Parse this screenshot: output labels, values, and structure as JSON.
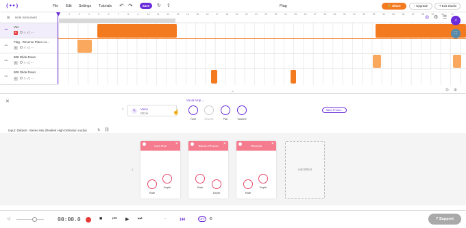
{
  "menu": {
    "file": "File",
    "edit": "Edit",
    "settings": "Settings",
    "tutorials": "Tutorials",
    "save": "Save"
  },
  "project_title": "Flag",
  "buttons": {
    "share": "Share",
    "upgrade": "Upgrade",
    "exit": "Exit Studio"
  },
  "hide_instrument": "Hide Instrument",
  "ruler": [
    "1",
    "2",
    "3",
    "4",
    "5",
    "6",
    "7",
    "8",
    "9",
    "10",
    "11",
    "12",
    "13",
    "14",
    "15",
    "16",
    "17",
    "18",
    "19",
    "20",
    "21",
    "22",
    "23",
    "24",
    "25",
    "26",
    "27",
    "28",
    "29",
    "30",
    "31",
    "32",
    "33",
    "34",
    "35",
    "36",
    "37",
    "38",
    "39",
    "40",
    "41"
  ],
  "tracks": [
    {
      "name": "Voc",
      "active": true
    },
    {
      "name": "Flag - Reverse Piano Lo...",
      "active": false
    },
    {
      "name": "808 Glide Down",
      "active": false
    },
    {
      "name": "808 Glide Down",
      "active": false
    }
  ],
  "instrument": {
    "voice_title": "Voice",
    "voice_sub": "Ditzie",
    "preset_name": "Vocal Amp",
    "knobs": [
      {
        "label": "Tone",
        "dim": false
      },
      {
        "label": "Reverb",
        "dim": true
      },
      {
        "label": "Pan",
        "dim": false
      },
      {
        "label": "Volume",
        "dim": false
      }
    ],
    "save_preset": "Save Preset..."
  },
  "input_label": "Input: Default - Stereo Mix (Realtek High Definition Audio)",
  "effects": [
    {
      "title": "Auto Pan",
      "knob1": "Rate",
      "knob2": "Depth"
    },
    {
      "title": "Stereo Chorus",
      "knob1": "Rate",
      "knob2": "Depth"
    },
    {
      "title": "Tremolo",
      "knob1": "Rate",
      "knob2": "Depth"
    }
  ],
  "add_effect": "Add Effect",
  "transport": {
    "time": "00:00.0",
    "dash": "-",
    "bpm": "140",
    "metronome": "OFF",
    "support": "Support"
  },
  "colors": {
    "accent": "#6a2bd9",
    "clip": "#f47a20",
    "effect_header": "#f47c8e"
  }
}
